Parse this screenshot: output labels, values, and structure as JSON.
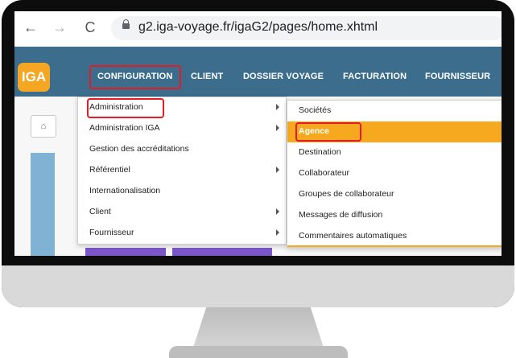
{
  "browser": {
    "back": "←",
    "forward": "→",
    "reload": "C",
    "url": "g2.iga-voyage.fr/igaG2/pages/home.xhtml"
  },
  "app": {
    "logo": "IGA",
    "menu": [
      "CONFIGURATION",
      "CLIENT",
      "DOSSIER VOYAGE",
      "FACTURATION",
      "FOURNISSEUR"
    ],
    "home_icon": "home-icon"
  },
  "dropdown": {
    "items": [
      {
        "label": "Administration",
        "has_submenu": true
      },
      {
        "label": "Administration IGA",
        "has_submenu": true
      },
      {
        "label": "Gestion des accréditations",
        "has_submenu": false
      },
      {
        "label": "Référentiel",
        "has_submenu": true
      },
      {
        "label": "Internationalisation",
        "has_submenu": false
      },
      {
        "label": "Client",
        "has_submenu": true
      },
      {
        "label": "Fournisseur",
        "has_submenu": true
      }
    ]
  },
  "submenu": {
    "items": [
      {
        "label": "Sociétés"
      },
      {
        "label": "Agence",
        "active": true
      },
      {
        "label": "Destination"
      },
      {
        "label": "Collaborateur"
      },
      {
        "label": "Groupes de collaborateur"
      },
      {
        "label": "Messages de diffusion"
      },
      {
        "label": "Commentaires automatiques"
      }
    ]
  },
  "colors": {
    "nav_bg": "#3c6d8d",
    "accent": "#f6a81f",
    "highlight_outline": "#e31b23",
    "monitor_frame": "#0d0d0d"
  }
}
